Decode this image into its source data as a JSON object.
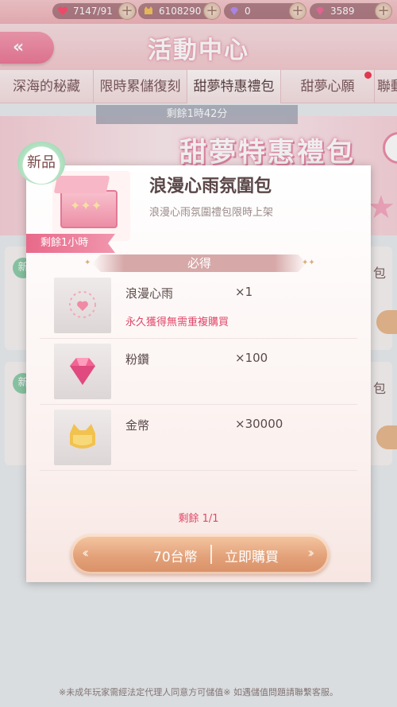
{
  "resources": {
    "stamina": "7147/91",
    "gold": "6108290",
    "diamond": "0",
    "pink_diamond": "3589"
  },
  "header": {
    "title": "活動中心"
  },
  "tabs": [
    {
      "label": "深海的秘藏"
    },
    {
      "label": "限時累儲復刻"
    },
    {
      "label": "甜夢特惠禮包"
    },
    {
      "label": "甜夢心願"
    },
    {
      "label": "聯動"
    }
  ],
  "timer": "剩餘1時42分",
  "banner": {
    "title": "甜夢特惠禮包"
  },
  "background_cards": [
    {
      "badge": "新",
      "side_label": "包"
    },
    {
      "badge": "新",
      "side_label": "包"
    }
  ],
  "popup": {
    "badge": "新品",
    "time_left": "剩餘1小時",
    "title": "浪漫心雨氛圍包",
    "subtitle": "浪漫心雨氛圍禮包限時上架",
    "section_label": "必得",
    "items": [
      {
        "name": "浪漫心雨",
        "qty": "×1",
        "note": "永久獲得無需重複購買"
      },
      {
        "name": "粉鑽",
        "qty": "×100",
        "note": ""
      },
      {
        "name": "金幣",
        "qty": "×30000",
        "note": ""
      }
    ],
    "remaining": "剩餘 1/1",
    "price": "70台幣",
    "buy_label": "立即購買"
  },
  "footer": "※未成年玩家需經法定代理人同意方可儲值※ 如遇儲值問題請聯繫客服。",
  "colors": {
    "accent_pink": "#ec7896",
    "buy_button": "#e3a27a",
    "red_text": "#e0486a"
  }
}
